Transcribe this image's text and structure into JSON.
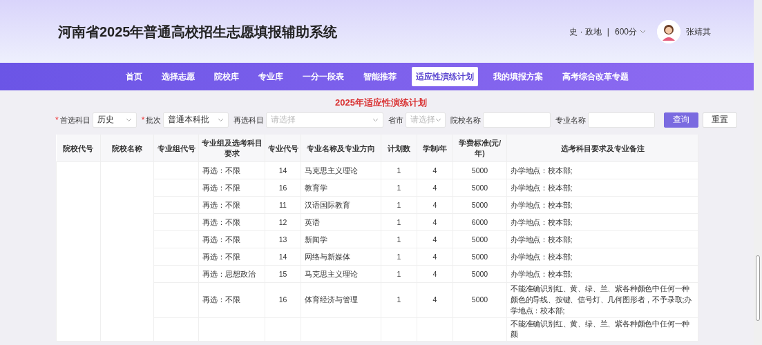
{
  "header": {
    "title": "河南省2025年普通高校招生志愿填报辅助系统",
    "subjects": "史 · 政地",
    "separator": "|",
    "score": "600分",
    "user_name": "张靖其"
  },
  "nav": [
    {
      "label": "首页",
      "selected": false
    },
    {
      "label": "选择志愿",
      "selected": false
    },
    {
      "label": "院校库",
      "selected": false
    },
    {
      "label": "专业库",
      "selected": false
    },
    {
      "label": "一分一段表",
      "selected": false
    },
    {
      "label": "智能推荐",
      "selected": false
    },
    {
      "label": "适应性演练计划",
      "selected": true
    },
    {
      "label": "我的填报方案",
      "selected": false
    },
    {
      "label": "高考综合改革专题",
      "selected": false
    }
  ],
  "page_title": "2025年适应性演练计划",
  "filters": [
    {
      "kind": "select",
      "required_mark": "*",
      "label": "首选科目",
      "value": "历史"
    },
    {
      "kind": "select",
      "required_mark": "*",
      "label": "批次",
      "value": "普通本科批"
    },
    {
      "kind": "select",
      "label": "再选科目",
      "placeholder": "请选择"
    },
    {
      "kind": "select",
      "label": "省市",
      "placeholder": "请选择"
    },
    {
      "kind": "text",
      "label": "院校名称"
    },
    {
      "kind": "text",
      "label": "专业名称"
    }
  ],
  "buttons": [
    {
      "label": "查询",
      "kind": "primary"
    },
    {
      "label": "重置",
      "kind": "plain"
    }
  ],
  "table": {
    "columns": [
      "院校代号",
      "院校名称",
      "专业组代号",
      "专业组及选考科目要求",
      "专业代号",
      "专业名称及专业方向",
      "计划数",
      "学制/年",
      "学费标准(元/年)",
      "选考科目要求及专业备注"
    ],
    "rows": [
      {
        "requirement": "再选：不限",
        "major_code": "14",
        "major_name": "马克思主义理论",
        "plan": "1",
        "years": "4",
        "fee": "5000",
        "note": "办学地点：校本部;"
      },
      {
        "requirement": "再选：不限",
        "major_code": "16",
        "major_name": "教育学",
        "plan": "1",
        "years": "4",
        "fee": "5000",
        "note": "办学地点：校本部;"
      },
      {
        "requirement": "再选：不限",
        "major_code": "11",
        "major_name": "汉语国际教育",
        "plan": "1",
        "years": "4",
        "fee": "5000",
        "note": "办学地点：校本部;"
      },
      {
        "requirement": "再选：不限",
        "major_code": "12",
        "major_name": "英语",
        "plan": "1",
        "years": "4",
        "fee": "6000",
        "note": "办学地点：校本部;"
      },
      {
        "requirement": "再选：不限",
        "major_code": "13",
        "major_name": "新闻学",
        "plan": "1",
        "years": "4",
        "fee": "5000",
        "note": "办学地点：校本部;"
      },
      {
        "requirement": "再选：不限",
        "major_code": "14",
        "major_name": "网络与新媒体",
        "plan": "1",
        "years": "4",
        "fee": "5000",
        "note": "办学地点：校本部;"
      },
      {
        "requirement": "再选：思想政治",
        "major_code": "15",
        "major_name": "马克思主义理论",
        "plan": "1",
        "years": "4",
        "fee": "5000",
        "note": "办学地点：校本部;"
      },
      {
        "requirement": "再选：不限",
        "major_code": "16",
        "major_name": "体育经济与管理",
        "plan": "1",
        "years": "4",
        "fee": "5000",
        "note": "不能准确识别红、黄、绿、兰、紫各种颜色中任何一种颜色的导线、按键、信号灯、几何图形者，不予录取;办学地点：校本部;"
      },
      {
        "note": "不能准确识别红、黄、绿、兰、紫各种颜色中任何一种颜"
      }
    ]
  }
}
